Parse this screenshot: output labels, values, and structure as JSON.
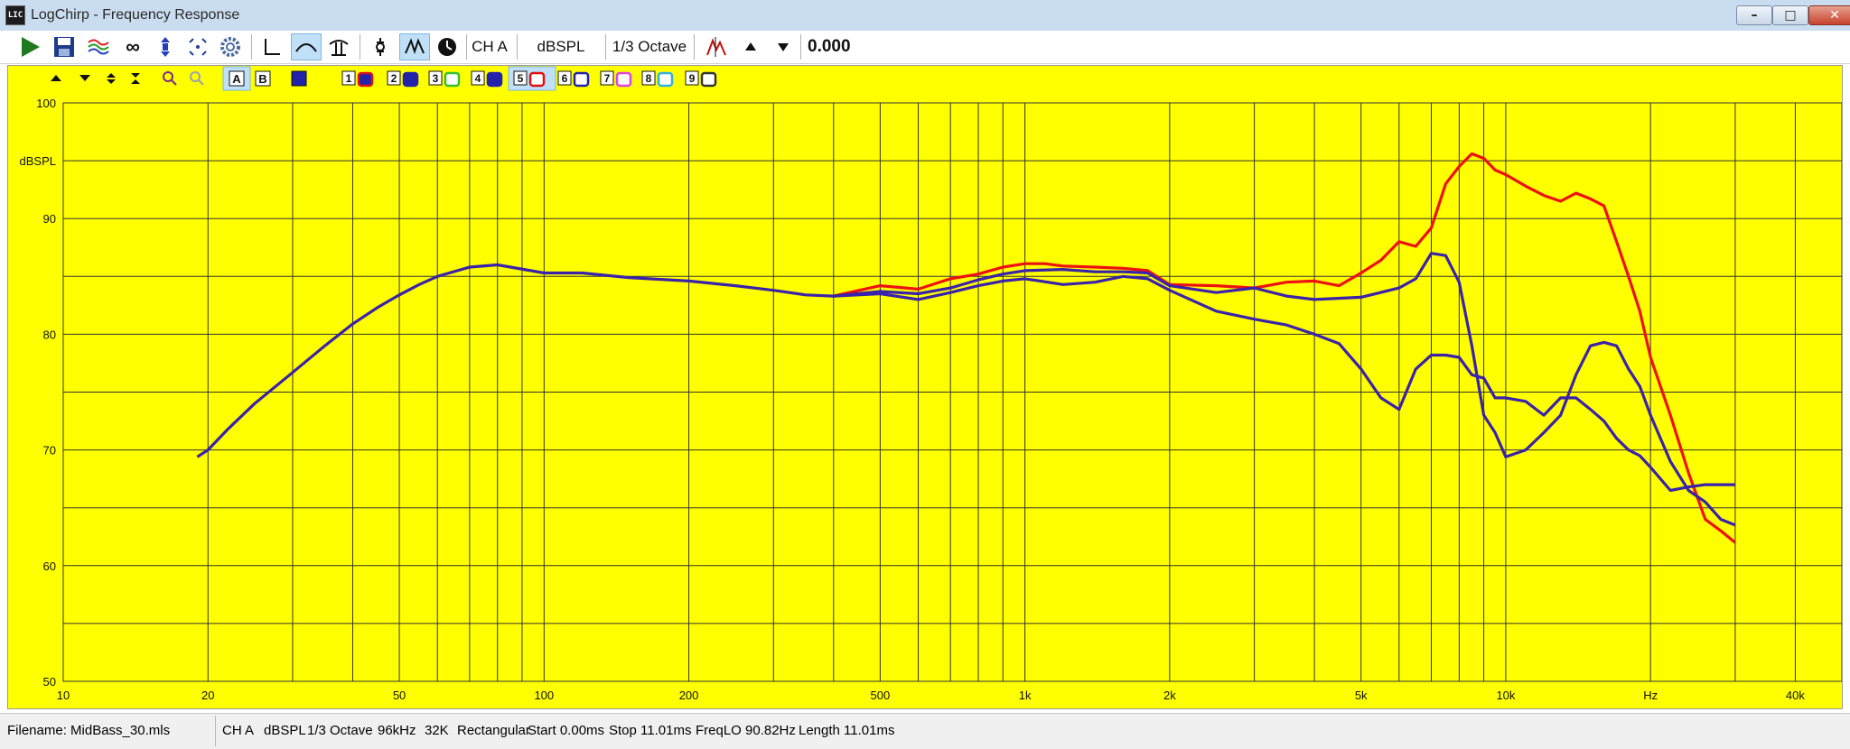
{
  "window": {
    "title": "LogChirp - Frequency Response",
    "app_icon_text": "LIC",
    "min": "–",
    "restore": "□",
    "close": "✕"
  },
  "toolbar": {
    "channel": "CH A",
    "unit": "dBSPL",
    "smoothing": "1/3 Octave",
    "value": "0.000",
    "icons": [
      "play-icon",
      "save-icon",
      "overlay-stack-icon",
      "infinity-icon",
      "marker-icon",
      "crosshair-icon",
      "gear-icon",
      "axis-icon",
      "curve-icon",
      "phase-icon",
      "impulse-icon",
      "filter-icon",
      "clock-icon",
      "peak-icon",
      "arrow-up-icon",
      "arrow-down-icon"
    ]
  },
  "chart_toolbar": {
    "a_label": "A",
    "b_label": "B",
    "overlays": [
      {
        "num": "1",
        "color": "#e01010",
        "fill": "#2222aa"
      },
      {
        "num": "2",
        "color": "#2222aa",
        "fill": "#2222aa"
      },
      {
        "num": "3",
        "color": "#30c030",
        "fill": "#ffffff"
      },
      {
        "num": "4",
        "color": "#2222aa",
        "fill": "#2222aa"
      },
      {
        "num": "5",
        "color": "#e01010",
        "fill": "#ffffff"
      },
      {
        "num": "6",
        "color": "#2222aa",
        "fill": "#ffffff"
      },
      {
        "num": "7",
        "color": "#e040e0",
        "fill": "#ffffff"
      },
      {
        "num": "8",
        "color": "#30b0e0",
        "fill": "#ffffff"
      },
      {
        "num": "9",
        "color": "#333333",
        "fill": "#ffffff"
      }
    ]
  },
  "status": {
    "filename": "Filename: MidBass_30.mls",
    "channel": "CH A",
    "unit": "dBSPL",
    "smoothing": "1/3 Octave",
    "rate": "96kHz",
    "size": "32K",
    "window": "Rectangular",
    "start": "Start 0.00ms",
    "stop": "Stop 11.01ms",
    "freqlo": "FreqLO 90.82Hz",
    "length": "Length 11.01ms"
  },
  "chart_data": {
    "type": "line",
    "xscale": "log",
    "xlim": [
      10,
      50000
    ],
    "ylim": [
      50,
      100
    ],
    "ylabel": "dBSPL",
    "xlabel_unit": "Hz",
    "x_tick_labels": [
      {
        "x": 10,
        "label": "10"
      },
      {
        "x": 20,
        "label": "20"
      },
      {
        "x": 50,
        "label": "50"
      },
      {
        "x": 100,
        "label": "100"
      },
      {
        "x": 200,
        "label": "200"
      },
      {
        "x": 500,
        "label": "500"
      },
      {
        "x": 1000,
        "label": "1k"
      },
      {
        "x": 2000,
        "label": "2k"
      },
      {
        "x": 5000,
        "label": "5k"
      },
      {
        "x": 10000,
        "label": "10k"
      },
      {
        "x": 20000,
        "label": "Hz"
      },
      {
        "x": 40000,
        "label": "40k"
      }
    ],
    "y_tick_labels": [
      {
        "y": 100,
        "label": "100"
      },
      {
        "y": 90,
        "label": "90"
      },
      {
        "y": 80,
        "label": "80"
      },
      {
        "y": 70,
        "label": "70"
      },
      {
        "y": 60,
        "label": "60"
      },
      {
        "y": 50,
        "label": "50"
      }
    ],
    "grid": true,
    "series": [
      {
        "color": "#ee1111",
        "x": [
          400,
          500,
          600,
          700,
          800,
          900,
          1000,
          1100,
          1200,
          1400,
          1600,
          1800,
          2000,
          2500,
          3000,
          3500,
          4000,
          4500,
          5000,
          5500,
          6000,
          6500,
          7000,
          7500,
          8000,
          8500,
          9000,
          9500,
          10000,
          11000,
          12000,
          13000,
          14000,
          15000,
          16000,
          17000,
          18000,
          19000,
          20000,
          22000,
          24000,
          26000,
          28000,
          30000
        ],
        "y": [
          83.3,
          84.2,
          83.9,
          84.8,
          85.2,
          85.8,
          86.1,
          86.1,
          85.9,
          85.8,
          85.7,
          85.5,
          84.3,
          84.2,
          84.0,
          84.5,
          84.6,
          84.2,
          85.3,
          86.4,
          88.0,
          87.6,
          89.2,
          93.0,
          94.5,
          95.6,
          95.2,
          94.2,
          93.8,
          92.8,
          92.0,
          91.5,
          92.2,
          91.7,
          91.1,
          88.0,
          85.0,
          82.0,
          78.0,
          73.0,
          68.0,
          64.0,
          63.0,
          62.0
        ]
      },
      {
        "color": "#3a22aa",
        "x": [
          19,
          20,
          22,
          25,
          30,
          35,
          40,
          45,
          50,
          55,
          60,
          70,
          80,
          100,
          120,
          150,
          200,
          250,
          300,
          350,
          400,
          500,
          600,
          700,
          800,
          900,
          1000,
          1200,
          1400,
          1600,
          1800,
          2000,
          2500,
          3000,
          3500,
          4000,
          5000,
          6000,
          6500,
          7000,
          7500,
          8000,
          8500,
          9000,
          9500,
          10000,
          11000,
          12000,
          13000,
          14000,
          15000,
          16000,
          17000,
          18000,
          19000,
          20000,
          22000,
          24000,
          26000,
          28000,
          30000
        ],
        "y": [
          69.4,
          70.0,
          71.8,
          74.0,
          76.7,
          79.0,
          80.9,
          82.3,
          83.4,
          84.3,
          85.0,
          85.8,
          86.0,
          85.3,
          85.3,
          84.9,
          84.6,
          84.2,
          83.8,
          83.4,
          83.3,
          83.7,
          83.5,
          84.0,
          84.7,
          85.2,
          85.5,
          85.6,
          85.4,
          85.4,
          85.3,
          84.2,
          83.6,
          84.0,
          83.3,
          83.0,
          83.2,
          84.0,
          84.8,
          87.0,
          86.8,
          84.5,
          79.0,
          73.0,
          71.5,
          69.4,
          70.0,
          71.5,
          73.0,
          76.5,
          79.0,
          79.3,
          79.0,
          77.0,
          75.5,
          73.0,
          69.0,
          66.5,
          65.5,
          64.0,
          63.5
        ]
      },
      {
        "color": "#3a22aa",
        "x": [
          400,
          500,
          600,
          700,
          800,
          900,
          1000,
          1200,
          1400,
          1600,
          1800,
          2000,
          2500,
          3000,
          3500,
          4000,
          4500,
          5000,
          5500,
          6000,
          6500,
          7000,
          7500,
          8000,
          8500,
          9000,
          9500,
          10000,
          11000,
          12000,
          13000,
          14000,
          15000,
          16000,
          17000,
          18000,
          19000,
          20000,
          22000,
          24000,
          26000,
          28000,
          30000
        ],
        "y": [
          83.3,
          83.5,
          83.0,
          83.6,
          84.2,
          84.6,
          84.8,
          84.3,
          84.5,
          85.0,
          84.8,
          83.8,
          82.0,
          81.3,
          80.8,
          80.0,
          79.2,
          77.0,
          74.5,
          73.5,
          77.0,
          78.2,
          78.2,
          78.0,
          76.5,
          76.2,
          74.5,
          74.5,
          74.2,
          73.0,
          74.5,
          74.5,
          73.5,
          72.5,
          71.0,
          70.0,
          69.5,
          68.5,
          66.5,
          66.8,
          67.0,
          67.0,
          67.0
        ]
      }
    ]
  }
}
